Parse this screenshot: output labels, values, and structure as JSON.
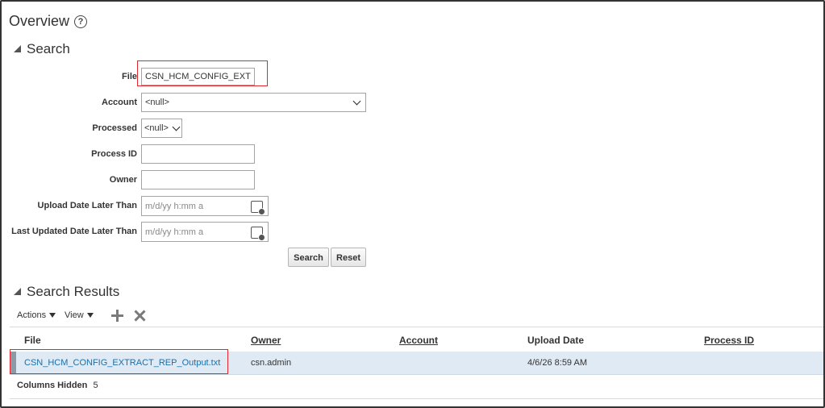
{
  "page": {
    "title": "Overview"
  },
  "search": {
    "title": "Search",
    "fields": {
      "file": {
        "label": "File",
        "value": "CSN_HCM_CONFIG_EXTR"
      },
      "account": {
        "label": "Account",
        "value": "<null>"
      },
      "processed": {
        "label": "Processed",
        "value": "<null>"
      },
      "process_id": {
        "label": "Process ID",
        "value": ""
      },
      "owner": {
        "label": "Owner",
        "value": ""
      },
      "upload_date": {
        "label": "Upload Date Later Than",
        "placeholder": "m/d/yy h:mm a"
      },
      "last_updated": {
        "label": "Last Updated Date Later Than",
        "placeholder": "m/d/yy h:mm a"
      }
    },
    "buttons": {
      "search": "Search",
      "reset": "Reset"
    }
  },
  "results": {
    "title": "Search Results",
    "toolbar": {
      "actions": "Actions",
      "view": "View"
    },
    "columns": [
      "File",
      "Owner",
      "Account",
      "Upload Date",
      "Process ID"
    ],
    "rows": [
      {
        "file": "CSN_HCM_CONFIG_EXTRACT_REP_Output.txt",
        "owner": "csn.admin",
        "account": "",
        "upload_date": "4/6/26 8:59 AM",
        "process_id": ""
      }
    ],
    "columns_hidden_label": "Columns Hidden",
    "columns_hidden_count": "5"
  },
  "colors": {
    "link": "#1a6fa8",
    "highlight": "#e3272d",
    "row_selected": "#dfeaf5"
  },
  "icons": [
    "help-icon",
    "collapse-triangle-icon",
    "chevron-down-icon",
    "calendar-icon",
    "add-icon",
    "delete-icon"
  ]
}
